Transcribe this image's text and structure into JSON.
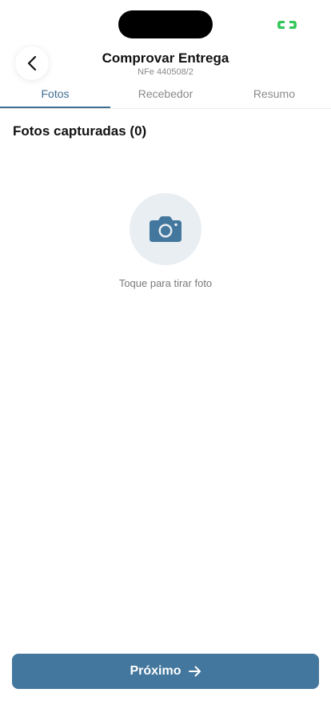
{
  "header": {
    "title": "Comprovar Entrega",
    "subtitle": "NFe 440508/2"
  },
  "tabs": [
    {
      "label": "Fotos",
      "active": true
    },
    {
      "label": "Recebedor",
      "active": false
    },
    {
      "label": "Resumo",
      "active": false
    }
  ],
  "photos": {
    "section_title": "Fotos capturadas (0)",
    "hint": "Toque para tirar foto"
  },
  "footer": {
    "next_label": "Próximo"
  },
  "icons": {
    "back": "chevron-left-icon",
    "camera": "camera-icon",
    "next": "arrow-right-icon",
    "status": "status-indicator-icon"
  },
  "colors": {
    "accent": "#43779d",
    "tab_active": "#3f6f93",
    "camera_bg": "#e9eef3",
    "status_green": "#34c759"
  }
}
